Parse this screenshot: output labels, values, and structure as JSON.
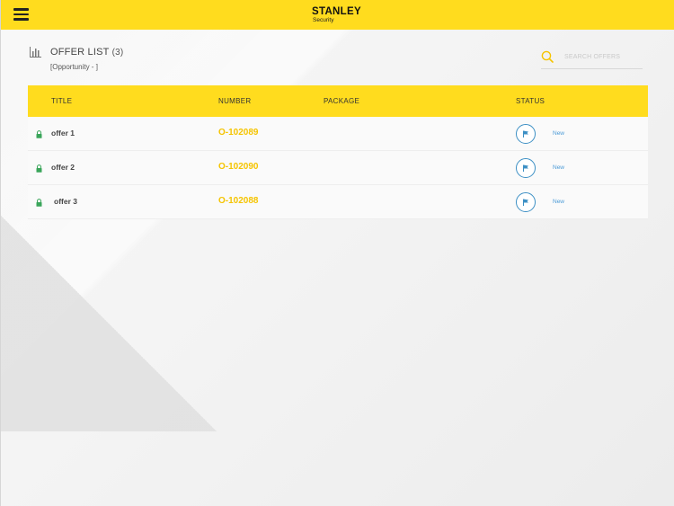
{
  "app": {
    "brand": "STANLEY",
    "brand_sub": "Security"
  },
  "header": {
    "title": "OFFER LIST",
    "count": "(3)",
    "subtitle": "[Opportunity - ]"
  },
  "search": {
    "placeholder": "SEARCH OFFERS"
  },
  "table": {
    "columns": {
      "title": "TITLE",
      "number": "NUMBER",
      "package": "PACKAGE",
      "status": "STATUS"
    },
    "rows": [
      {
        "title": "offer 1",
        "number": "O-102089",
        "package": "",
        "status": "New"
      },
      {
        "title": "offer 2",
        "number": "O-102090",
        "package": "",
        "status": "New"
      },
      {
        "title": "offer 3",
        "number": "O-102088",
        "package": "",
        "status": "New"
      }
    ]
  },
  "colors": {
    "accent": "#ffdc1e",
    "number_text": "#f5c400",
    "status_blue": "#3c8fc4",
    "lock_green": "#3aa55a"
  },
  "icons": {
    "menu": "hamburger-icon",
    "list": "list-chart-icon",
    "search": "search-icon",
    "lock": "lock-icon",
    "status": "flag-icon"
  }
}
